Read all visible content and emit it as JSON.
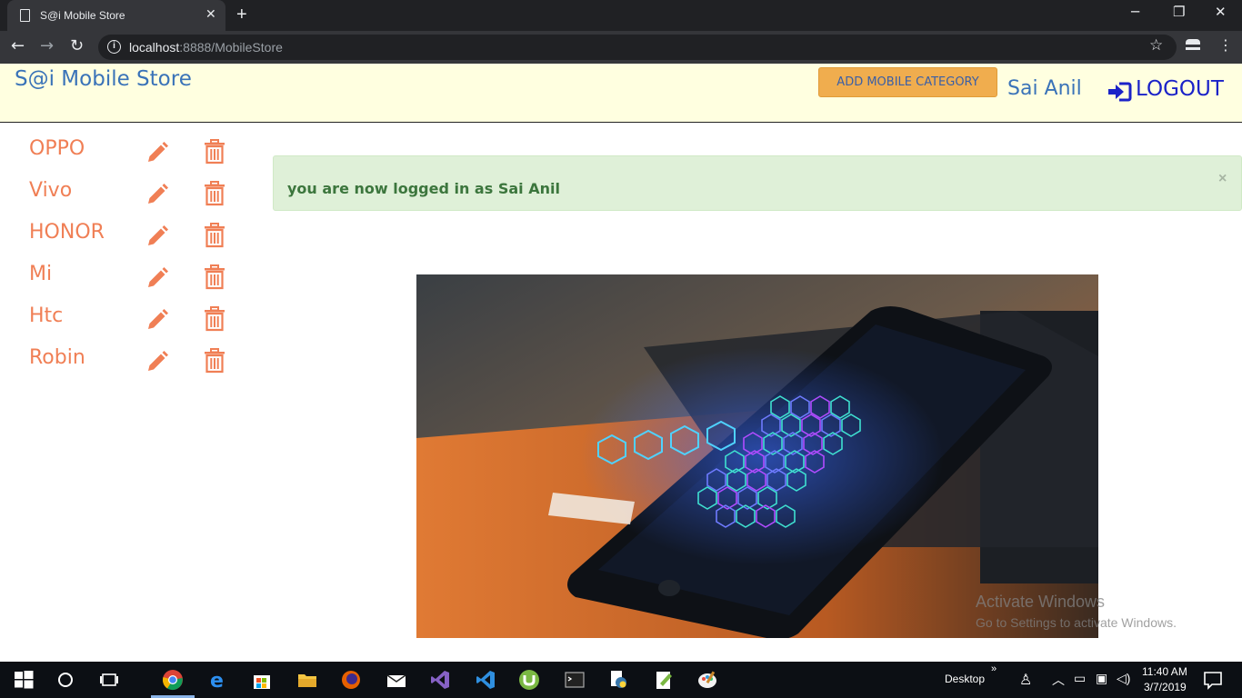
{
  "browser": {
    "tab_title": "S@i Mobile Store",
    "url_host": "localhost",
    "url_path": ":8888/MobileStore"
  },
  "header": {
    "brand": "S@i Mobile Store",
    "add_category_label": "ADD MOBILE CATEGORY",
    "username": "Sai Anil",
    "logout_label": "LOGOUT"
  },
  "categories": [
    {
      "name": "OPPO"
    },
    {
      "name": "Vivo"
    },
    {
      "name": "HONOR"
    },
    {
      "name": "Mi"
    },
    {
      "name": "Htc"
    },
    {
      "name": "Robin"
    }
  ],
  "alert": {
    "message": "you are now logged in as Sai Anil",
    "close": "×"
  },
  "watermark": {
    "line1": "Activate Windows",
    "line2": "Go to Settings to activate Windows."
  },
  "taskbar": {
    "desktop_label": "Desktop",
    "time": "11:40 AM",
    "date": "3/7/2019"
  },
  "colors": {
    "header_bg": "#ffffe0",
    "brand": "#3a73b8",
    "accent_button": "#f0ad4e",
    "category": "#f07f55",
    "alert_bg": "#dff0d8",
    "alert_text": "#3c763d",
    "logout": "#1a22c8"
  },
  "icons": {
    "edit": "pencil-icon",
    "delete": "trash-icon",
    "logout": "sign-in-icon"
  }
}
